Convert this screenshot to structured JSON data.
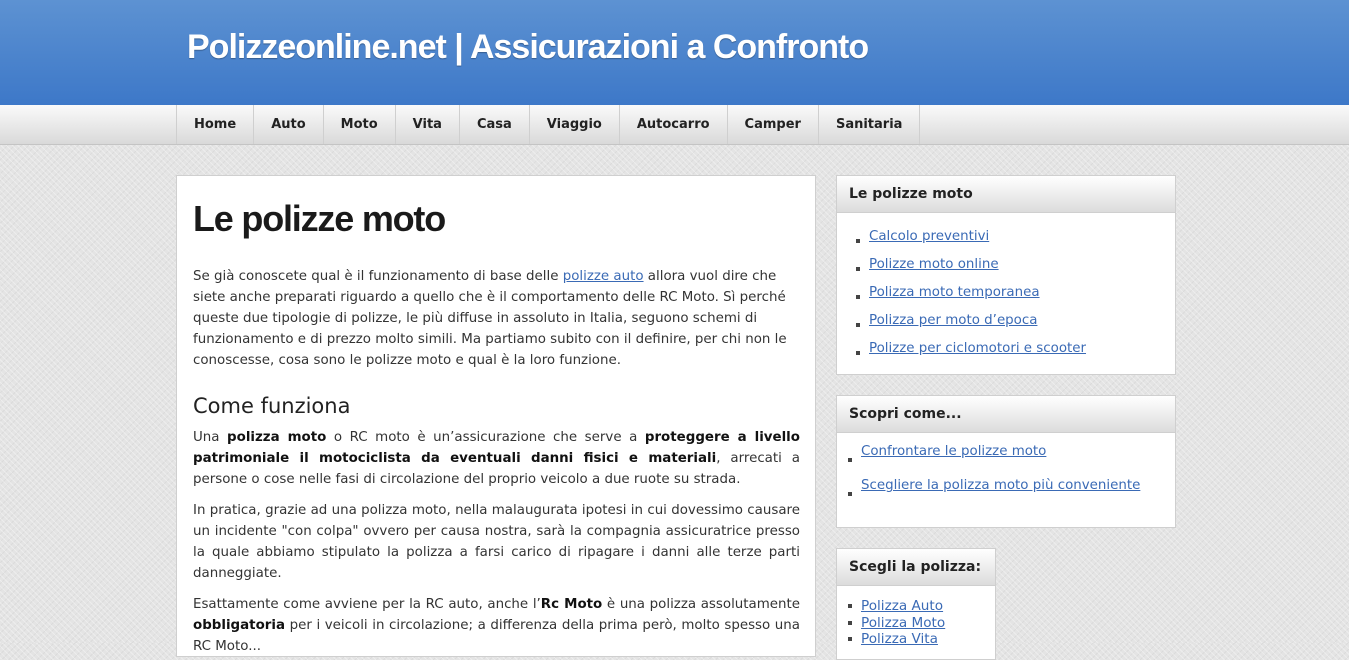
{
  "header": {
    "site_title": "Polizzeonline.net | Assicurazioni a Confronto"
  },
  "nav": {
    "items": [
      "Home",
      "Auto",
      "Moto",
      "Vita",
      "Casa",
      "Viaggio",
      "Autocarro",
      "Camper",
      "Sanitaria"
    ]
  },
  "article": {
    "title": "Le polizze moto",
    "intro_before_link": "Se già conoscete qual è il funzionamento di base delle ",
    "intro_link": "polizze auto",
    "intro_after_link": " allora vuol dire che siete anche preparati riguardo a quello che è il comportamento delle RC Moto. Sì perché queste due tipologie di polizze, le più diffuse in assoluto in Italia, seguono schemi di funzionamento e di prezzo molto simili. Ma partiamo subito con il definire, per chi non le conoscesse, cosa sono le polizze moto e qual è la loro funzione.",
    "section_title": "Come funziona",
    "p2_a": "Una ",
    "p2_b": "polizza moto",
    "p2_c": " o RC moto è un’assicurazione che serve a ",
    "p2_d": "proteggere a livello patrimoniale il motociclista da eventuali danni fisici e materiali",
    "p2_e": ", arrecati a persone o cose nelle fasi di circolazione del proprio veicolo a due ruote su strada.",
    "p3": "In pratica, grazie ad una polizza moto, nella malaugurata ipotesi in cui dovessimo causare un incidente \"con colpa\" ovvero per causa nostra, sarà la compagnia assicuratrice presso la quale abbiamo stipulato la polizza a farsi carico di ripagare i danni alle terze parti danneggiate.",
    "p4_a": "Esattamente come avviene per la RC auto, anche l’",
    "p4_b": "Rc Moto",
    "p4_c": " è una polizza assolutamente ",
    "p4_d": "obbligatoria",
    "p4_e": " per i veicoli in circolazione; a differenza della prima però, molto spesso una RC Moto..."
  },
  "sidebar": {
    "widget1": {
      "title": "Le polizze moto",
      "items": [
        "Calcolo preventivi",
        "Polizze moto online",
        "Polizza moto temporanea",
        "Polizza per moto d’epoca",
        "Polizze per ciclomotori e scooter"
      ]
    },
    "widget2": {
      "title": "Scopri come...",
      "items": [
        "Confrontare le polizze moto",
        "Scegliere la polizza moto più conveniente"
      ]
    },
    "widget3": {
      "title": "Scegli la polizza:",
      "items": [
        "Polizza Auto",
        "Polizza Moto",
        "Polizza Vita"
      ]
    }
  },
  "colors": {
    "header_blue": "#4a84cc",
    "link_blue": "#3a6ab5"
  }
}
